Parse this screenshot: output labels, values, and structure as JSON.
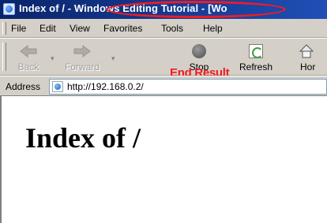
{
  "window": {
    "title": "Index of / - Windows Editing Tutorial - [Wo"
  },
  "annotation": {
    "label": "End Result",
    "color": "#ee1d23"
  },
  "menu": {
    "items": [
      "File",
      "Edit",
      "View",
      "Favorites",
      "Tools",
      "Help"
    ]
  },
  "toolbar": {
    "back_label": "Back",
    "forward_label": "Forward",
    "stop_label": "Stop",
    "refresh_label": "Refresh",
    "home_label": "Hor"
  },
  "address_bar": {
    "label": "Address",
    "url": "http://192.168.0.2/"
  },
  "page": {
    "heading": "Index of /"
  },
  "icons": {
    "app": "ie-logo-icon",
    "back": "back-arrow-icon",
    "forward": "forward-arrow-icon",
    "stop": "stop-icon",
    "refresh": "refresh-icon",
    "home": "home-icon",
    "page": "page-icon"
  },
  "colors": {
    "titlebar_start": "#0a246a",
    "titlebar_end": "#1f4fb6",
    "chrome": "#d4d0c8"
  }
}
